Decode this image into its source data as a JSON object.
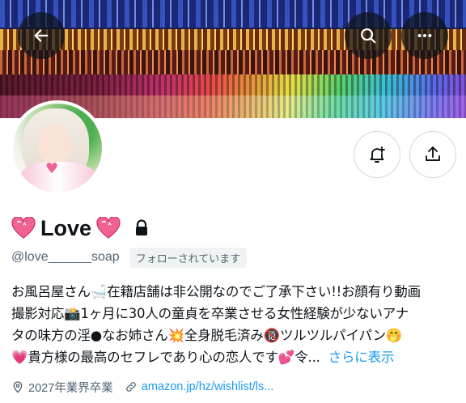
{
  "header": {
    "back_icon": "arrow-left-icon",
    "search_icon": "search-icon",
    "more_icon": "more-horizontal-icon"
  },
  "actions": {
    "notify_icon": "bell-plus-icon",
    "share_icon": "share-icon"
  },
  "profile": {
    "display_name": "Love",
    "name_emoji": "heart-emoji",
    "protected_icon": "lock-icon",
    "handle": "@love______soap",
    "follows_you_badge": "フォローされています"
  },
  "bio": {
    "line1": "お風呂屋さん🛁在籍店舗は非公開なのでご了承下さい!!お顔有り動画",
    "line2": "撮影対応📸1ヶ月に30人の童貞を卒業させる女性経験が少ないアナ",
    "line3": "タの味方の淫●なお姉さん💥全身脱毛済み🔞ツルツルパイパン🤭",
    "line4": "💗貴方様の最高のセフレであり心の恋人です💕令...",
    "show_more": "さらに表示"
  },
  "meta": {
    "location": "2027年業界卒業",
    "location_icon": "location-pin-icon",
    "website": "amazon.jp/hz/wishlist/ls...",
    "website_icon": "link-icon"
  },
  "colors": {
    "link": "#1d9bf0",
    "secondary_text": "#536471",
    "heart": "#f06292"
  }
}
